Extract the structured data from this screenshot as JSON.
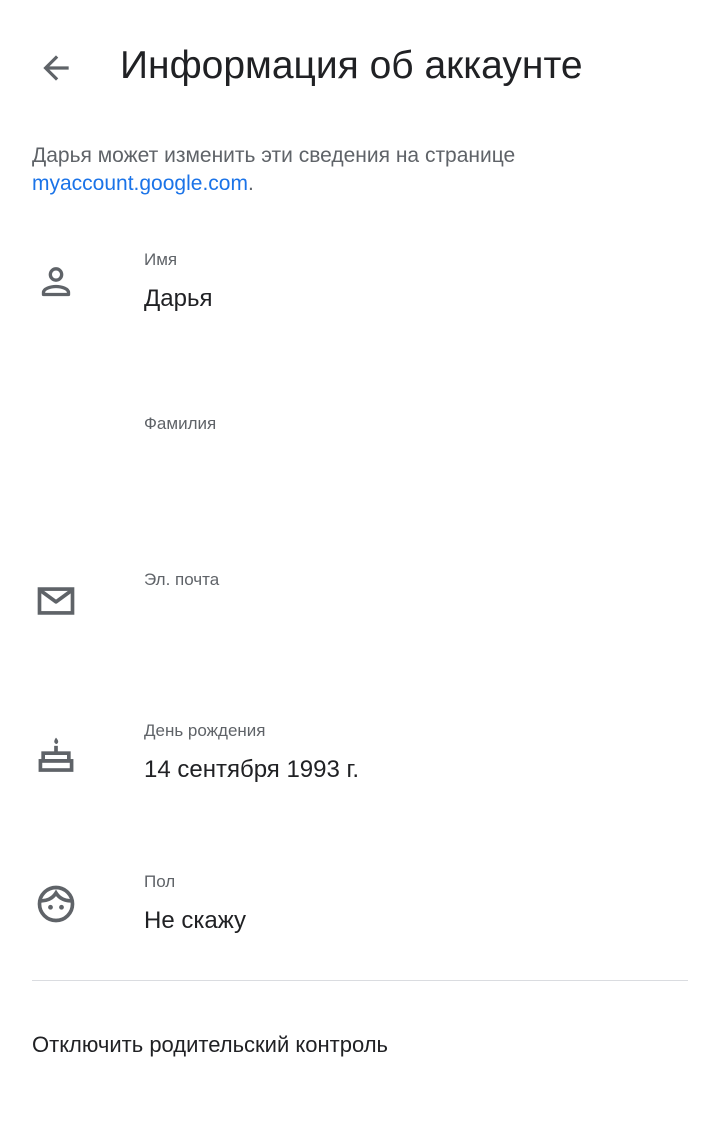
{
  "header": {
    "title": "Информация об аккаунте",
    "back_icon": "arrow-back-icon"
  },
  "description": {
    "text": "Дарья может изменить эти сведения на странице",
    "link": "myaccount.google.com",
    "suffix": "."
  },
  "fields": {
    "first_name": {
      "label": "Имя",
      "value": "Дарья",
      "icon": "person-icon"
    },
    "last_name": {
      "label": "Фамилия",
      "value": ""
    },
    "email": {
      "label": "Эл. почта",
      "value": "",
      "icon": "mail-icon"
    },
    "birthday": {
      "label": "День рождения",
      "value": "14 сентября 1993 г.",
      "icon": "cake-icon"
    },
    "gender": {
      "label": "Пол",
      "value": "Не скажу",
      "icon": "face-icon"
    }
  },
  "actions": {
    "disable_parental_control": "Отключить родительский контроль"
  },
  "colors": {
    "text_primary": "#202124",
    "text_secondary": "#5f6368",
    "link": "#1a73e8",
    "icon": "#5f6368",
    "divider": "#dadce0"
  }
}
